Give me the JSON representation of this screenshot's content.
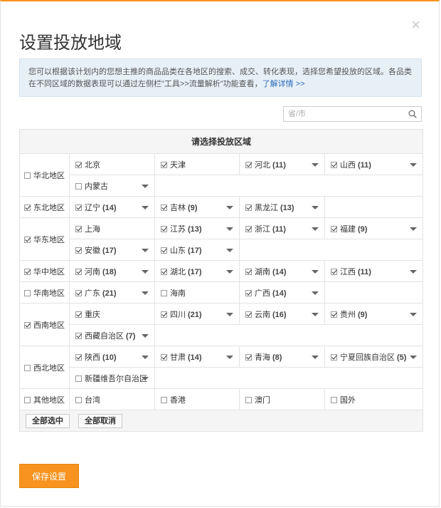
{
  "dialog": {
    "title": "设置投放地域",
    "close_glyph": "×",
    "notice_text": "您可以根据该计划内的您想主推的商品品类在各地区的搜索、成交、转化表现，选择您希望投放的区域。各品类在不同区域的数据表现可以通过左侧栏\"工具>>流量解析\"功能查看，",
    "notice_link": "了解详情 >>",
    "search_placeholder": "省/市",
    "table_header": "请选择投放区域",
    "select_all": "全部选中",
    "deselect_all": "全部取消",
    "save": "保存设置"
  },
  "regions": [
    {
      "name": "华北地区",
      "checked": false,
      "rows": [
        [
          {
            "name": "北京",
            "count": "",
            "checked": true,
            "dropdown": false
          },
          {
            "name": "天津",
            "count": "",
            "checked": true,
            "dropdown": false
          },
          {
            "name": "河北",
            "count": "(11)",
            "checked": true,
            "dropdown": true
          },
          {
            "name": "山西",
            "count": "(11)",
            "checked": true,
            "dropdown": true
          }
        ],
        [
          {
            "name": "内蒙古",
            "count": "",
            "checked": false,
            "dropdown": true
          }
        ]
      ]
    },
    {
      "name": "东北地区",
      "checked": true,
      "rows": [
        [
          {
            "name": "辽宁",
            "count": "(14)",
            "checked": true,
            "dropdown": true
          },
          {
            "name": "吉林",
            "count": "(9)",
            "checked": true,
            "dropdown": true
          },
          {
            "name": "黑龙江",
            "count": "(13)",
            "checked": true,
            "dropdown": true
          }
        ]
      ]
    },
    {
      "name": "华东地区",
      "checked": true,
      "rows": [
        [
          {
            "name": "上海",
            "count": "",
            "checked": true,
            "dropdown": false
          },
          {
            "name": "江苏",
            "count": "(13)",
            "checked": true,
            "dropdown": true
          },
          {
            "name": "浙江",
            "count": "(11)",
            "checked": true,
            "dropdown": true
          },
          {
            "name": "福建",
            "count": "(9)",
            "checked": true,
            "dropdown": true
          }
        ],
        [
          {
            "name": "安徽",
            "count": "(17)",
            "checked": true,
            "dropdown": true
          },
          {
            "name": "山东",
            "count": "(17)",
            "checked": true,
            "dropdown": true
          }
        ]
      ]
    },
    {
      "name": "华中地区",
      "checked": true,
      "rows": [
        [
          {
            "name": "河南",
            "count": "(18)",
            "checked": true,
            "dropdown": true
          },
          {
            "name": "湖北",
            "count": "(17)",
            "checked": true,
            "dropdown": true
          },
          {
            "name": "湖南",
            "count": "(14)",
            "checked": true,
            "dropdown": true
          },
          {
            "name": "江西",
            "count": "(11)",
            "checked": true,
            "dropdown": true
          }
        ]
      ]
    },
    {
      "name": "华南地区",
      "checked": false,
      "rows": [
        [
          {
            "name": "广东",
            "count": "(21)",
            "checked": true,
            "dropdown": true
          },
          {
            "name": "海南",
            "count": "",
            "checked": false,
            "dropdown": false
          },
          {
            "name": "广西",
            "count": "(14)",
            "checked": true,
            "dropdown": true
          }
        ]
      ]
    },
    {
      "name": "西南地区",
      "checked": true,
      "rows": [
        [
          {
            "name": "重庆",
            "count": "",
            "checked": true,
            "dropdown": false
          },
          {
            "name": "四川",
            "count": "(21)",
            "checked": true,
            "dropdown": true
          },
          {
            "name": "云南",
            "count": "(16)",
            "checked": true,
            "dropdown": true
          },
          {
            "name": "贵州",
            "count": "(9)",
            "checked": true,
            "dropdown": true
          }
        ],
        [
          {
            "name": "西藏自治区",
            "count": "(7)",
            "checked": true,
            "dropdown": true
          }
        ]
      ]
    },
    {
      "name": "西北地区",
      "checked": false,
      "rows": [
        [
          {
            "name": "陕西",
            "count": "(10)",
            "checked": true,
            "dropdown": true
          },
          {
            "name": "甘肃",
            "count": "(14)",
            "checked": true,
            "dropdown": true
          },
          {
            "name": "青海",
            "count": "(8)",
            "checked": true,
            "dropdown": true
          },
          {
            "name": "宁夏回族自治区",
            "count": "(5)",
            "checked": true,
            "dropdown": true
          }
        ],
        [
          {
            "name": "新疆维吾尔自治区",
            "count": "",
            "checked": false,
            "dropdown": true
          }
        ]
      ]
    },
    {
      "name": "其他地区",
      "checked": false,
      "rows": [
        [
          {
            "name": "台湾",
            "count": "",
            "checked": false,
            "dropdown": false
          },
          {
            "name": "香港",
            "count": "",
            "checked": false,
            "dropdown": false
          },
          {
            "name": "澳门",
            "count": "",
            "checked": false,
            "dropdown": false
          },
          {
            "name": "国外",
            "count": "",
            "checked": false,
            "dropdown": false
          }
        ]
      ]
    }
  ]
}
